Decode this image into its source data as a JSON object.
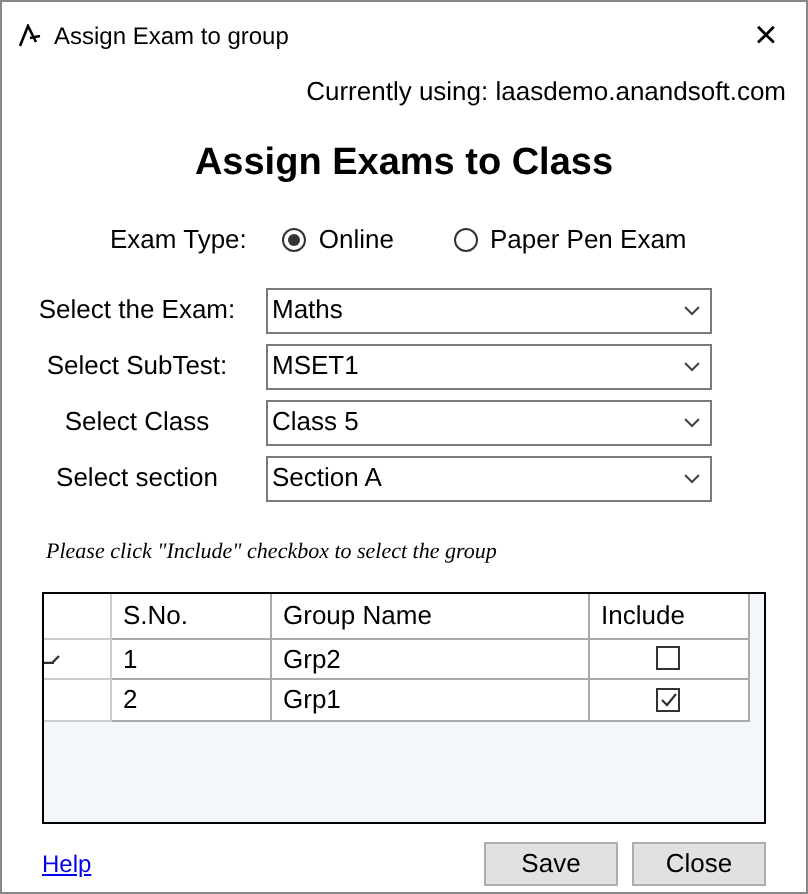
{
  "window": {
    "title": "Assign Exam to group",
    "close": "×"
  },
  "connection": "Currently using: laasdemo.anandsoft.com",
  "heading": "Assign Exams to Class",
  "exam_type": {
    "label": "Exam Type:",
    "options": [
      {
        "label": "Online",
        "selected": true
      },
      {
        "label": "Paper Pen Exam",
        "selected": false
      }
    ]
  },
  "selects": [
    {
      "label": "Select the Exam:",
      "value": "Maths"
    },
    {
      "label": "Select SubTest:",
      "value": "MSET1"
    },
    {
      "label": "Select Class",
      "value": "Class 5"
    },
    {
      "label": "Select section",
      "value": "Section A"
    }
  ],
  "note": "Please click \"Include\" checkbox to select the group",
  "table": {
    "columns": [
      "S.No.",
      "Group Name",
      "Include"
    ],
    "rows": [
      {
        "sno": "1",
        "name": "Grp2",
        "include": false,
        "editing": true
      },
      {
        "sno": "2",
        "name": "Grp1",
        "include": true,
        "editing": false
      }
    ]
  },
  "help": "Help",
  "buttons": [
    "Save",
    "Close"
  ]
}
